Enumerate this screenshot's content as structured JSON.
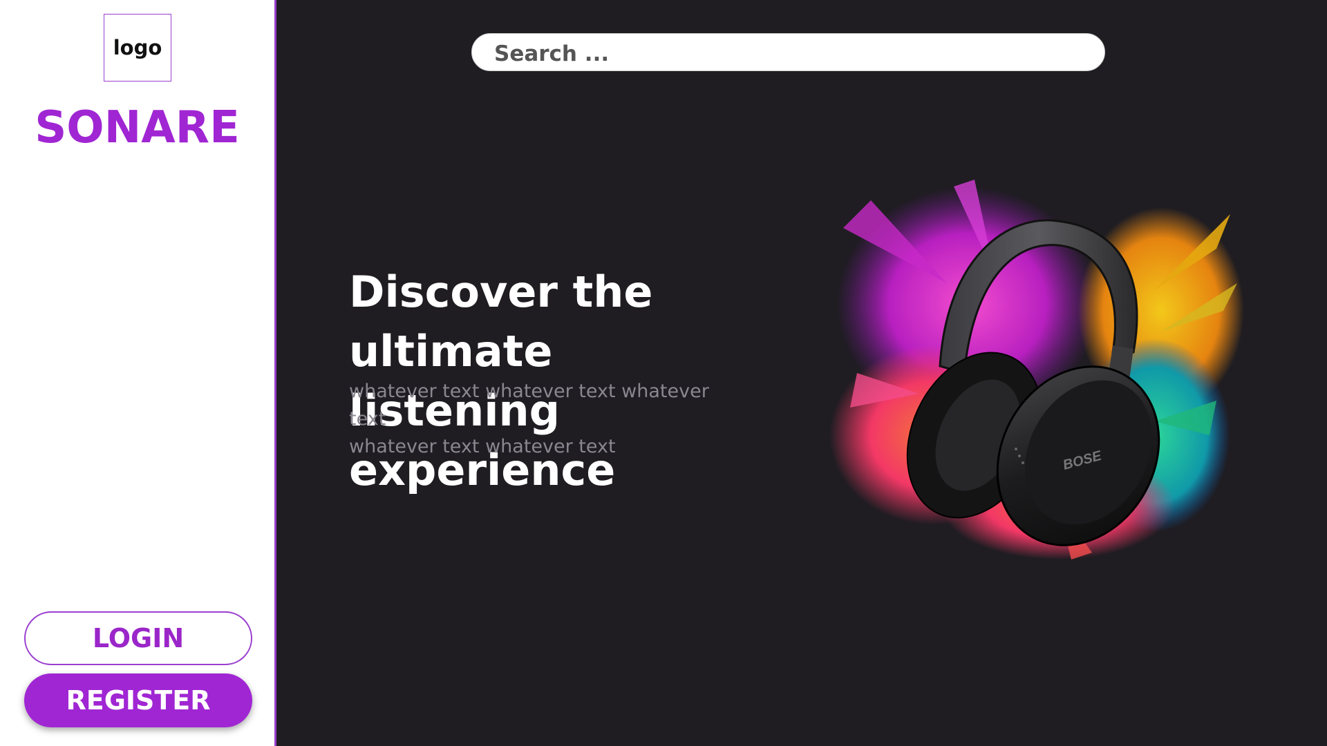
{
  "sidebar": {
    "logo_text": "logo",
    "brand_name": "SONARE",
    "login_label": "LOGIN",
    "register_label": "REGISTER"
  },
  "search": {
    "placeholder": "Search ..."
  },
  "hero": {
    "title_line1": "Discover the ultimate",
    "title_line2": "listening experience",
    "subtitle_line1": "whatever text whatever text whatever text",
    "subtitle_line2": "whatever text whatever text",
    "image_brand_text": "BOSE"
  },
  "colors": {
    "accent": "#a026d3",
    "background": "#1f1d22",
    "sidebar_bg": "#ffffff"
  }
}
